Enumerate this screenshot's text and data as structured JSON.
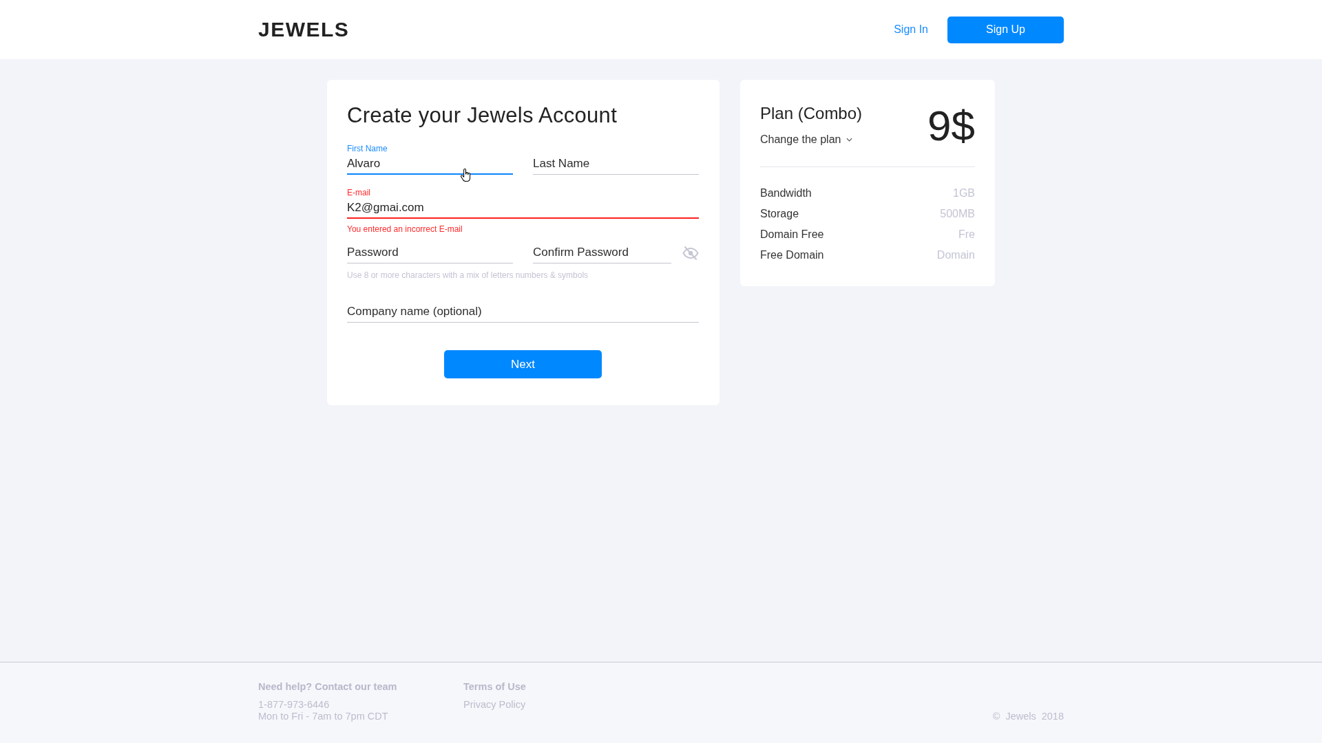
{
  "header": {
    "logo": "JEWELS",
    "nav": [
      {
        "label": "Sign In",
        "kind": "link"
      },
      {
        "label": "Sign Up",
        "kind": "button"
      }
    ]
  },
  "form": {
    "title": "Create your Jewels Account",
    "rows": [
      {
        "fields": [
          {
            "label": "First Name",
            "value": "Alvaro",
            "focused": true,
            "invalid": false
          },
          {
            "placeholder": "Last Name",
            "focused": false,
            "invalid": false
          }
        ]
      },
      {
        "fields": [
          {
            "label": "E-mail",
            "value": "K2@gmai.com",
            "focused": false,
            "invalid": true,
            "error": "You entered an incorrect E-mail"
          }
        ]
      },
      {
        "fields": [
          {
            "placeholder": "Password",
            "focused": false,
            "invalid": false
          },
          {
            "placeholder": "Confirm Password",
            "focused": false,
            "invalid": false
          }
        ],
        "password_visible": false,
        "hint": "Use 8 or more characters with a mix of letters numbers & symbols"
      },
      {
        "fields": [
          {
            "placeholder": "Company name (optional)",
            "focused": false,
            "invalid": false
          }
        ]
      }
    ],
    "submit": "Next"
  },
  "plan": {
    "title": "Plan (Combo)",
    "change_label": "Change the plan",
    "price": "9$",
    "features": [
      {
        "name": "Bandwidth",
        "value": "1GB"
      },
      {
        "name": "Storage",
        "value": "500MB"
      },
      {
        "name": "Domain Free",
        "value": "Fre"
      },
      {
        "name": "Free Domain",
        "value": "Domain"
      }
    ]
  },
  "footer": {
    "columns": [
      {
        "title": "Need help? Contact our team",
        "lines": [
          "1-877-973-6446",
          "Mon to Fri - 7am to 7pm CDT"
        ]
      },
      {
        "title": "Terms of Use",
        "lines": [
          "Privacy Policy"
        ]
      }
    ],
    "copyright": "© Jewels 2018"
  }
}
